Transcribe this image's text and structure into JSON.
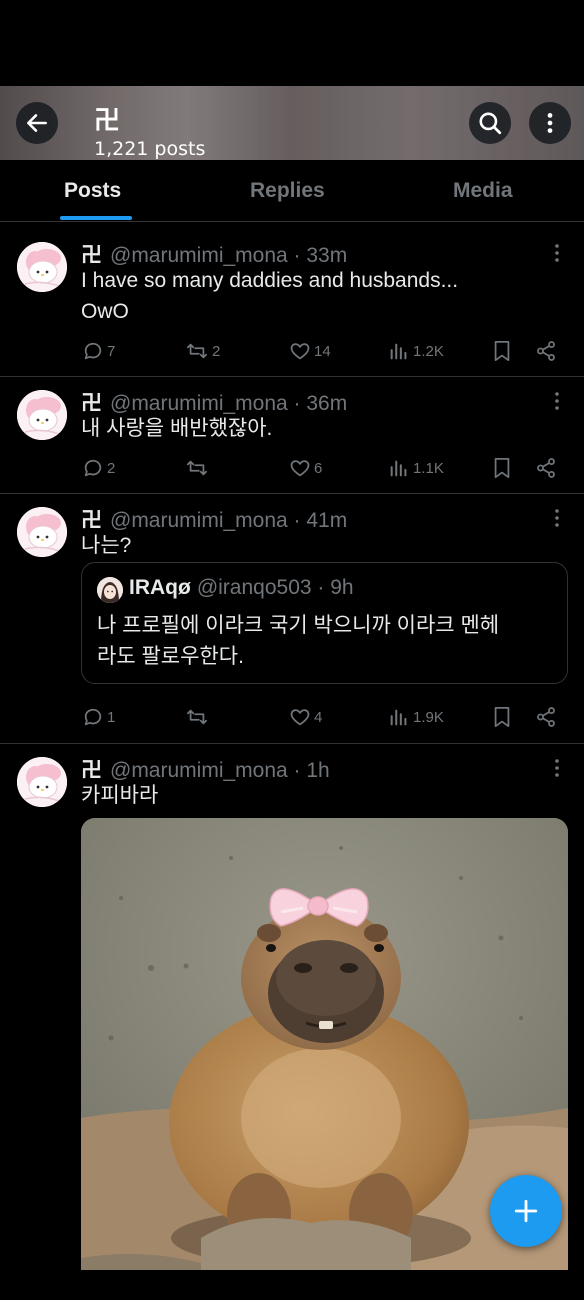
{
  "header": {
    "name": "卍",
    "post_count": "1,221 posts"
  },
  "tabs": [
    {
      "label": "Posts",
      "active": true
    },
    {
      "label": "Replies",
      "active": false
    },
    {
      "label": "Media",
      "active": false
    }
  ],
  "posts": [
    {
      "name": "卍",
      "handle": "@marumimi_mona",
      "time": "· 33m",
      "text_lines": [
        "I have so many daddies and husbands...",
        "OwO"
      ],
      "stats": {
        "replies": "7",
        "reposts": "2",
        "likes": "14",
        "views": "1.2K"
      }
    },
    {
      "name": "卍",
      "handle": "@marumimi_mona",
      "time": "· 36m",
      "text_lines": [
        "내 사랑을 배반했잖아."
      ],
      "stats": {
        "replies": "2",
        "reposts": "",
        "likes": "6",
        "views": "1.1K"
      }
    },
    {
      "name": "卍",
      "handle": "@marumimi_mona",
      "time": "· 41m",
      "text_lines": [
        "나는?"
      ],
      "quote": {
        "name": "IRAqø",
        "handle": "@iranqo503",
        "time": "· 9h",
        "text_lines": [
          "나 프로필에 이라크 국기 박으니까 이라크 멘헤",
          "라도 팔로우한다."
        ]
      },
      "stats": {
        "replies": "1",
        "reposts": "",
        "likes": "4",
        "views": "1.9K"
      }
    },
    {
      "name": "卍",
      "handle": "@marumimi_mona",
      "time": "· 1h",
      "text_lines": [
        "카피바라"
      ],
      "media": "capybara-with-pink-bow"
    }
  ],
  "icons": {
    "back": "back-arrow-icon",
    "search": "search-icon",
    "more": "more-vertical-icon",
    "reply": "reply-icon",
    "repost": "repost-icon",
    "like": "heart-icon",
    "views": "views-icon",
    "bookmark": "bookmark-icon",
    "share": "share-icon",
    "compose": "plus-icon"
  },
  "colors": {
    "accent": "#1d9bf0",
    "background": "#000000",
    "text": "#e7e9ea",
    "muted": "#71767b",
    "divider": "#2f3336"
  }
}
